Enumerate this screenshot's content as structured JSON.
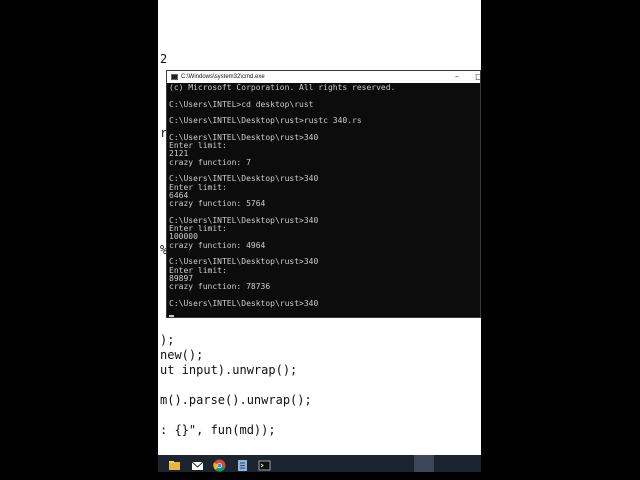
{
  "editor": {
    "code_lines": [
      "2",
      "r",
      "%",
      ");",
      "new();",
      "ut input).unwrap();",
      "m().parse().unwrap();",
      ": {}\", fun(md));"
    ]
  },
  "cmd_window": {
    "title": "C:\\Windows\\system32\\cmd.exe",
    "minimize_glyph": "–",
    "restore_glyph": "□",
    "lines": [
      "(c) Microsoft Corporation. All rights reserved.",
      "",
      "C:\\Users\\INTEL>cd desktop\\rust",
      "",
      "C:\\Users\\INTEL\\Desktop\\rust>rustc 340.rs",
      "",
      "C:\\Users\\INTEL\\Desktop\\rust>340",
      "Enter limit:",
      "2121",
      "crazy function: 7",
      "",
      "C:\\Users\\INTEL\\Desktop\\rust>340",
      "Enter limit:",
      "6464",
      "crazy function: 5764",
      "",
      "C:\\Users\\INTEL\\Desktop\\rust>340",
      "Enter limit:",
      "100000",
      "crazy function: 4964",
      "",
      "C:\\Users\\INTEL\\Desktop\\rust>340",
      "Enter limit:",
      "89897",
      "crazy function: 78736",
      "",
      "C:\\Users\\INTEL\\Desktop\\rust>340"
    ]
  },
  "taskbar": {
    "icons": [
      "file-explorer-icon",
      "mail-icon",
      "chrome-icon",
      "notepad-icon",
      "cmd-icon"
    ],
    "colors": {
      "background": "#1c2430",
      "explorer": "#e8b83a",
      "mail": "#ffffff",
      "chrome": "#db4437",
      "notepad": "#8fb3d9",
      "cmd": "#111111"
    }
  }
}
